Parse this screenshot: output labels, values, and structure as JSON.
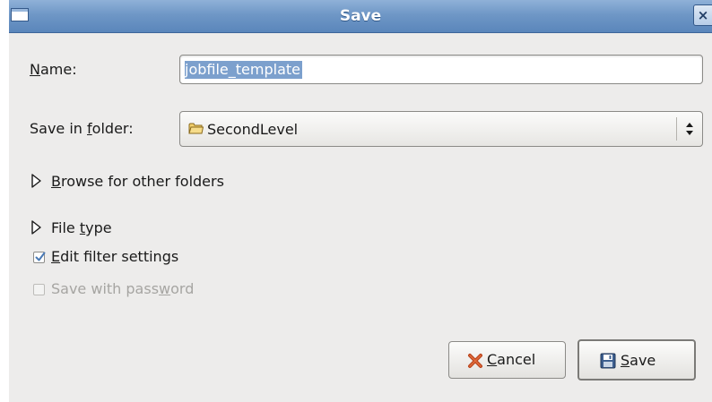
{
  "window": {
    "title": "Save",
    "close_glyph": "×"
  },
  "form": {
    "name_label_mnemonic": "N",
    "name_label_rest": "ame:",
    "name_value": "jobfile_template",
    "folder_label_pre": "Save in ",
    "folder_label_mnemonic": "f",
    "folder_label_post": "older:",
    "folder_value": "SecondLevel",
    "folder_icon": "folder-icon"
  },
  "expanders": {
    "browse_mnemonic": "B",
    "browse_rest": "rowse for other folders",
    "filetype_pre": "File ",
    "filetype_mnemonic": "t",
    "filetype_post": "ype"
  },
  "options": {
    "edit_filter_mnemonic": "E",
    "edit_filter_rest": "dit filter settings",
    "edit_filter_checked": true,
    "password_pre": "Save with pass",
    "password_mnemonic": "w",
    "password_post": "ord",
    "password_checked": false,
    "password_enabled": false
  },
  "buttons": {
    "cancel_mnemonic": "C",
    "cancel_rest": "ancel",
    "cancel_icon": "cancel-x-icon",
    "save_mnemonic": "S",
    "save_rest": "ave",
    "save_icon": "floppy-disk-icon"
  },
  "colors": {
    "titlebar": "#6f97c6",
    "selection": "#7ca0cd",
    "dialog_bg": "#edeceb",
    "checkmark": "#4a7ab5",
    "cancel_x": "#b8431c"
  }
}
